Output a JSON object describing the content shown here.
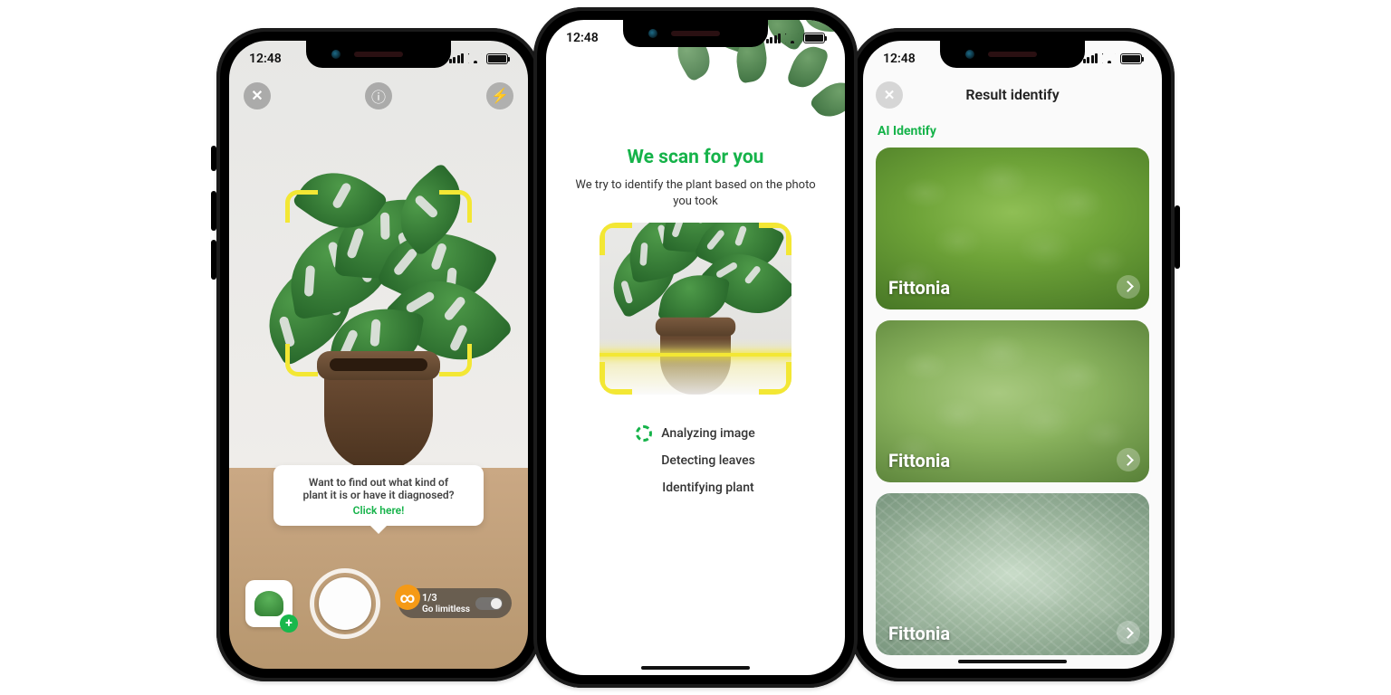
{
  "status": {
    "time": "12:48"
  },
  "p1": {
    "counter": "1/3",
    "limitless": "Go limitless",
    "tooltip_line1": "Want to find out what kind of",
    "tooltip_line2": "plant it is or have it diagnosed?",
    "tooltip_cta": "Click here!"
  },
  "p2": {
    "title": "We scan for you",
    "subtitle": "We try to identify the plant based on the photo you took",
    "step1": "Analyzing image",
    "step2": "Detecting leaves",
    "step3": "Identifying plant"
  },
  "p3": {
    "title": "Result identify",
    "section": "AI Identify",
    "results": [
      {
        "name": "Fittonia"
      },
      {
        "name": "Fittonia"
      },
      {
        "name": "Fittonia"
      }
    ]
  }
}
